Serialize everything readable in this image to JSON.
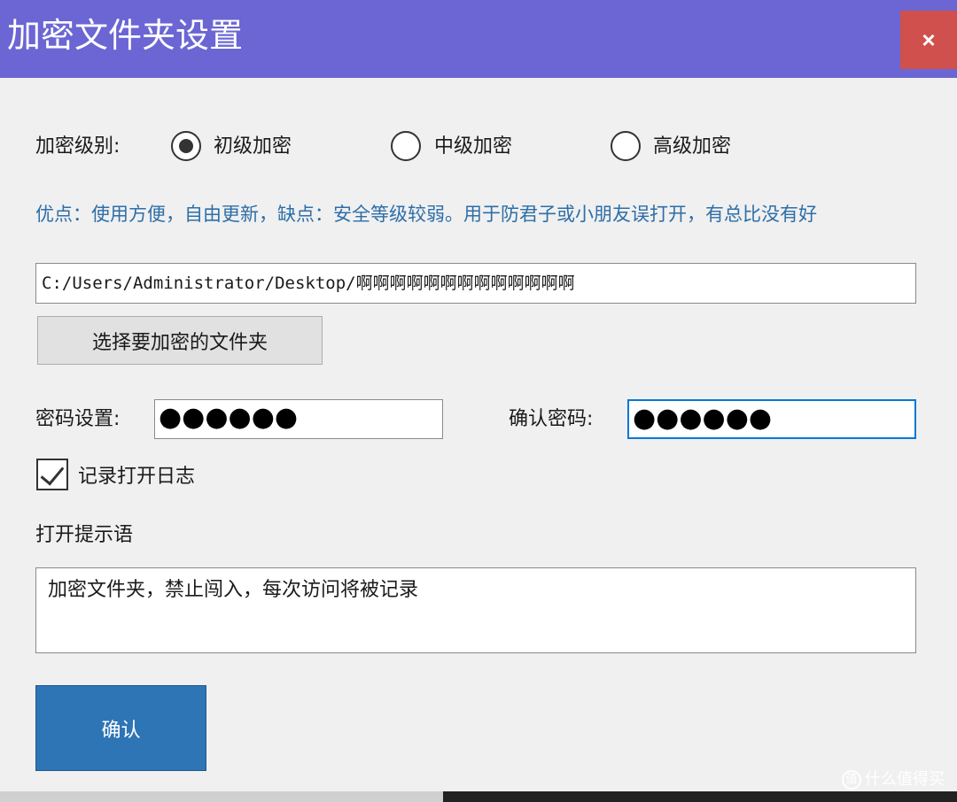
{
  "window": {
    "title": "加密文件夹设置",
    "close_glyph": "×"
  },
  "level": {
    "label": "加密级别:",
    "options": [
      {
        "label": "初级加密",
        "checked": true
      },
      {
        "label": "中级加密",
        "checked": false
      },
      {
        "label": "高级加密",
        "checked": false
      }
    ],
    "description": "优点：使用方便，自由更新，缺点：安全等级较弱。用于防君子或小朋友误打开，有总比没有好"
  },
  "folder": {
    "path": "C:/Users/Administrator/Desktop/啊啊啊啊啊啊啊啊啊啊啊啊啊",
    "select_button": "选择要加密的文件夹"
  },
  "password": {
    "set_label": "密码设置:",
    "set_value": "●●●●●●",
    "confirm_label": "确认密码:",
    "confirm_value": "●●●●●●"
  },
  "log": {
    "label": "记录打开日志",
    "checked": true
  },
  "hint": {
    "label": "打开提示语",
    "value": "加密文件夹，禁止闯入，每次访问将被记录"
  },
  "confirm_button": "确认",
  "watermark": "什么值得买",
  "colors": {
    "titlebar": "#6b66d3",
    "close": "#d0504d",
    "description": "#2d6ea8",
    "confirm": "#2e75b6"
  }
}
